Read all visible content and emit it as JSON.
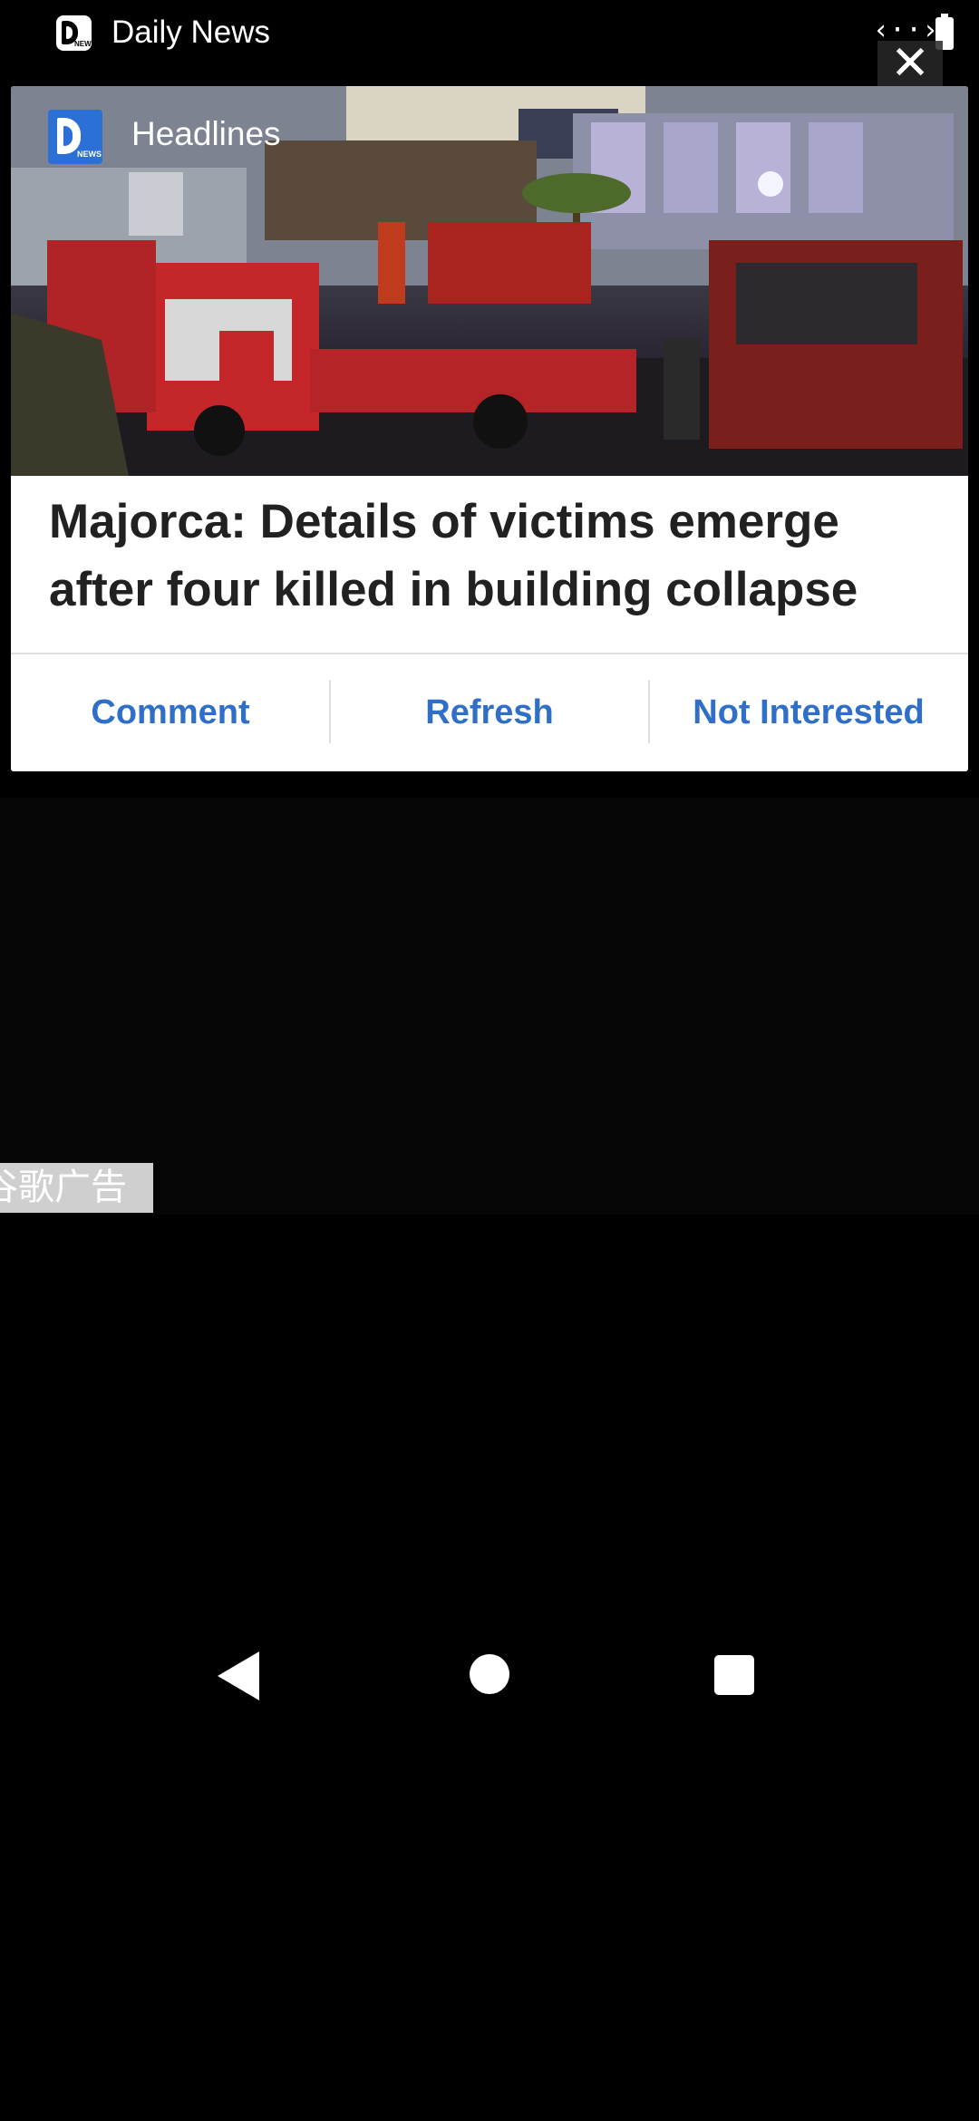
{
  "status_bar": {
    "app_name": "Daily News",
    "icons": [
      "daily-news-app-icon",
      "code-icon",
      "battery-icon"
    ],
    "code_glyph": "‹··›"
  },
  "notification": {
    "category": "Headlines",
    "close_glyph": "✕",
    "headline": "Majorca: Details of victims emerge after four killed in building collapse",
    "actions": {
      "comment": "Comment",
      "refresh": "Refresh",
      "not_interested": "Not Interested"
    },
    "accent_color": "#2f6fc7",
    "logo_color": "#2c6fd6",
    "logo_small_text": "NEWS"
  },
  "ad": {
    "label": "谷歌广告"
  },
  "nav_bar": {
    "buttons": [
      "back",
      "home",
      "recents"
    ]
  }
}
